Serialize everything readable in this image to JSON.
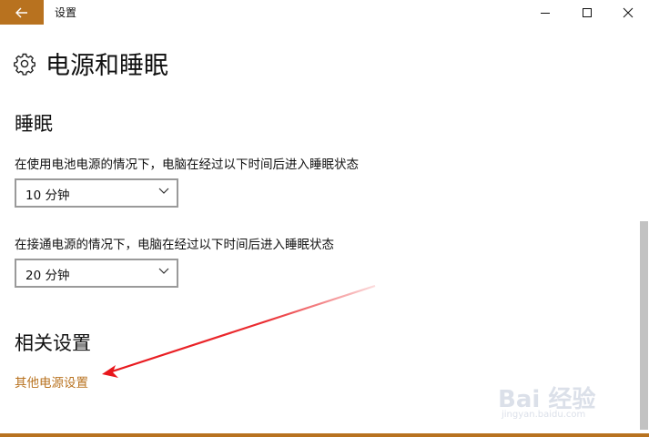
{
  "window": {
    "app_title": "设置",
    "accent_color": "#b8721f"
  },
  "page": {
    "title": "电源和睡眠",
    "icon": "gear-icon"
  },
  "sleep": {
    "section_title": "睡眠",
    "battery_label": "在使用电池电源的情况下，电脑在经过以下时间后进入睡眠状态",
    "battery_value": "10 分钟",
    "plugged_label": "在接通电源的情况下，电脑在经过以下时间后进入睡眠状态",
    "plugged_value": "20 分钟"
  },
  "related": {
    "section_title": "相关设置",
    "link_text": "其他电源设置"
  },
  "watermark": {
    "brand": "Bai 经验",
    "url": "jingyan.baidu.com"
  }
}
